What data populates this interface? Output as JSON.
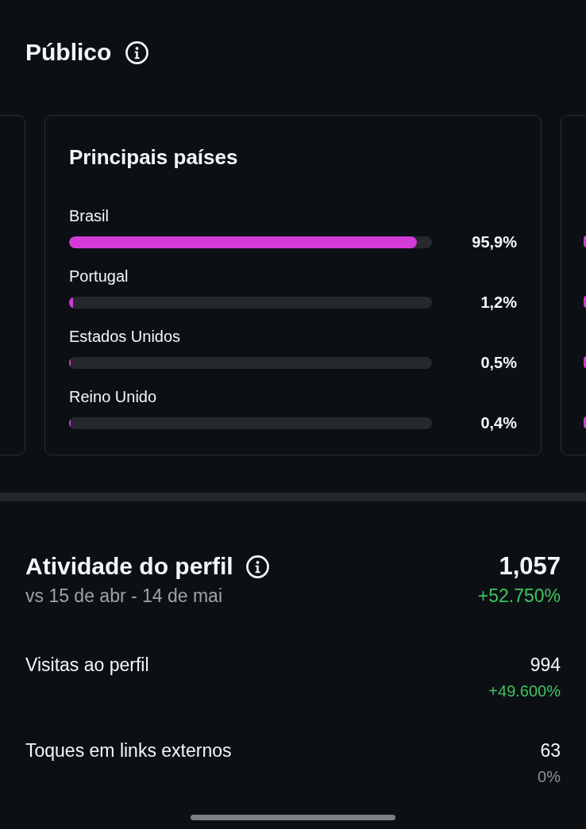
{
  "audience": {
    "title": "Público",
    "top_countries": {
      "title": "Principais países",
      "rows": [
        {
          "name": "Brasil",
          "level": 0.959,
          "reading": "95,9%"
        },
        {
          "name": "Portugal",
          "level": 0.012,
          "reading": "1,2%"
        },
        {
          "name": "Estados Unidos",
          "level": 0.005,
          "reading": "0,5%"
        },
        {
          "name": "Reino Unido",
          "level": 0.004,
          "reading": "0,4%"
        }
      ]
    }
  },
  "profile_activity": {
    "title": "Atividade do perfil",
    "total": "1,057",
    "comparison": "vs 15 de abr - 14 de mai",
    "change": {
      "text": "+52.750%",
      "positive": true
    },
    "metrics": [
      {
        "label": "Visitas ao perfil",
        "value": "994",
        "change": {
          "text": "+49.600%",
          "positive": true
        }
      },
      {
        "label": "Toques em links externos",
        "value": "63",
        "change": {
          "text": "0%",
          "positive": false
        }
      }
    ]
  }
}
